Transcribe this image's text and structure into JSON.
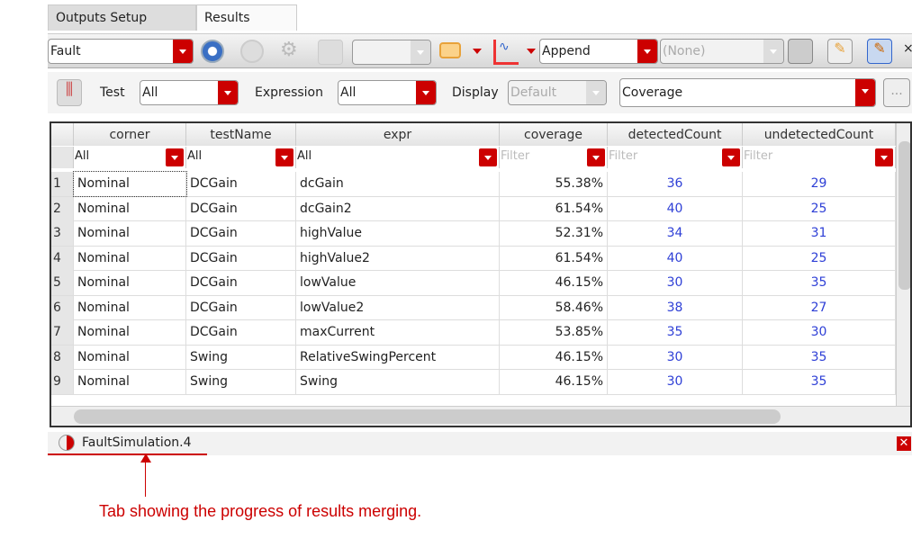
{
  "tabs": [
    {
      "label": "Outputs Setup",
      "active": false
    },
    {
      "label": "Results",
      "active": true
    }
  ],
  "toolbar": {
    "mode": "Fault",
    "history": "",
    "merge_mode": "Append",
    "reference": "(None)"
  },
  "filters": {
    "test_label": "Test",
    "test_value": "All",
    "expression_label": "Expression",
    "expression_value": "All",
    "display_label": "Display",
    "display_value": "Default",
    "view": "Coverage",
    "more_label": "..."
  },
  "table": {
    "columns": [
      "corner",
      "testName",
      "expr",
      "coverage",
      "detectedCount",
      "undetectedCount"
    ],
    "column_filters": [
      "All",
      "All",
      "All",
      "Filter",
      "Filter",
      "Filter"
    ],
    "rows": [
      [
        "1",
        "Nominal",
        "DCGain",
        "dcGain",
        "55.38%",
        "36",
        "29"
      ],
      [
        "2",
        "Nominal",
        "DCGain",
        "dcGain2",
        "61.54%",
        "40",
        "25"
      ],
      [
        "3",
        "Nominal",
        "DCGain",
        "highValue",
        "52.31%",
        "34",
        "31"
      ],
      [
        "4",
        "Nominal",
        "DCGain",
        "highValue2",
        "61.54%",
        "40",
        "25"
      ],
      [
        "5",
        "Nominal",
        "DCGain",
        "lowValue",
        "46.15%",
        "30",
        "35"
      ],
      [
        "6",
        "Nominal",
        "DCGain",
        "lowValue2",
        "58.46%",
        "38",
        "27"
      ],
      [
        "7",
        "Nominal",
        "DCGain",
        "maxCurrent",
        "53.85%",
        "35",
        "30"
      ],
      [
        "8",
        "Nominal",
        "Swing",
        "RelativeSwingPercent",
        "46.15%",
        "30",
        "35"
      ],
      [
        "9",
        "Nominal",
        "Swing",
        "Swing",
        "46.15%",
        "30",
        "35"
      ]
    ]
  },
  "bottom_tab": {
    "label": "FaultSimulation.4",
    "progress": 0.5
  },
  "annotation": "Tab showing the progress of results merging.",
  "colors": {
    "accent": "#cc0000",
    "link": "#2e3fd6"
  }
}
